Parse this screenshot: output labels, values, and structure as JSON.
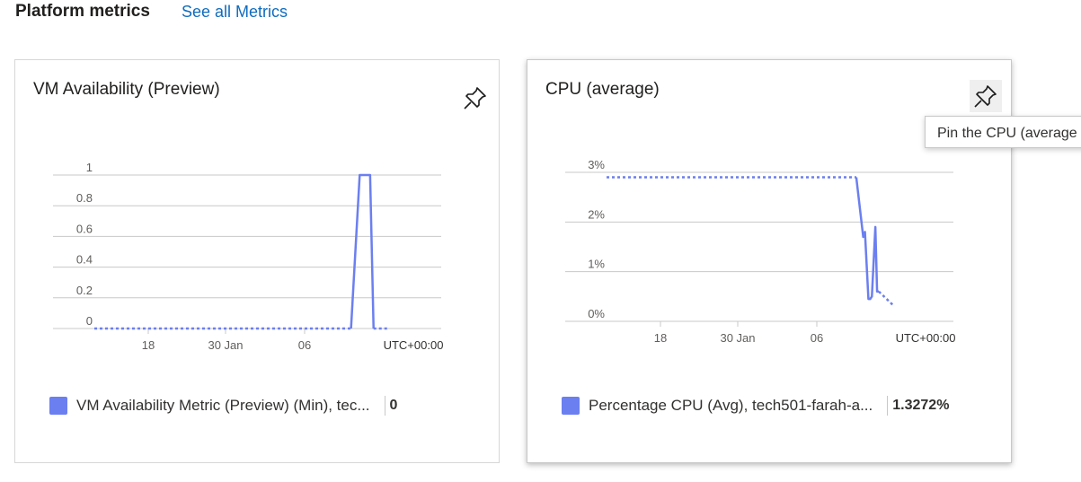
{
  "header": {
    "title": "Platform metrics",
    "link_label": "See all Metrics"
  },
  "tooltip": {
    "text": "Pin the CPU (average"
  },
  "cards": [
    {
      "title": "VM Availability (Preview)",
      "pin_icon": "pin-icon"
    },
    {
      "title": "CPU (average)",
      "pin_icon": "pin-icon"
    }
  ],
  "legends": [
    {
      "text": "VM Availability Metric (Preview) (Min), tec...",
      "value": "0",
      "color": "#6b7ff0"
    },
    {
      "text": "Percentage CPU (Avg), tech501-farah-a...",
      "value": "1.3272%",
      "color": "#6b7ff0"
    }
  ],
  "chart_data": [
    {
      "type": "line",
      "title": "VM Availability (Preview)",
      "y_ticks": [
        "1",
        "0.8",
        "0.6",
        "0.4",
        "0.2",
        "0"
      ],
      "ylim": [
        0,
        1
      ],
      "x_ticks": [
        "18",
        "30 Jan",
        "06"
      ],
      "timezone_label": "UTC+00:00",
      "grid": true,
      "series": [
        {
          "name": "VM Availability Metric (Preview) (Min), tec...",
          "color": "#6b7ff0",
          "dotted_x": [
            0,
            0.74
          ],
          "dotted_y": [
            0,
            0
          ],
          "x": [
            0.74,
            0.765,
            0.795,
            0.805
          ],
          "y": [
            0,
            1,
            1,
            0
          ],
          "dotted_tail_x": [
            0.805,
            0.85
          ],
          "dotted_tail_y": [
            0,
            0
          ]
        }
      ]
    },
    {
      "type": "line",
      "title": "CPU (average)",
      "y_ticks": [
        "3%",
        "2%",
        "1%",
        "0%"
      ],
      "ylim": [
        0,
        3
      ],
      "x_ticks": [
        "18",
        "30 Jan",
        "06"
      ],
      "timezone_label": "UTC+00:00",
      "grid": true,
      "series": [
        {
          "name": "Percentage CPU (Avg), tech501-farah-a...",
          "color": "#6b7ff0",
          "dotted_x": [
            0.0,
            0.72
          ],
          "dotted_y": [
            2.9,
            2.9
          ],
          "x": [
            0.72,
            0.74,
            0.745,
            0.755,
            0.76,
            0.765,
            0.775,
            0.78,
            0.785
          ],
          "y": [
            2.9,
            1.7,
            1.8,
            0.45,
            0.45,
            0.5,
            1.9,
            0.6,
            0.6
          ],
          "dotted_tail_x": [
            0.785,
            0.83
          ],
          "dotted_tail_y": [
            0.6,
            0.3
          ]
        }
      ]
    }
  ]
}
